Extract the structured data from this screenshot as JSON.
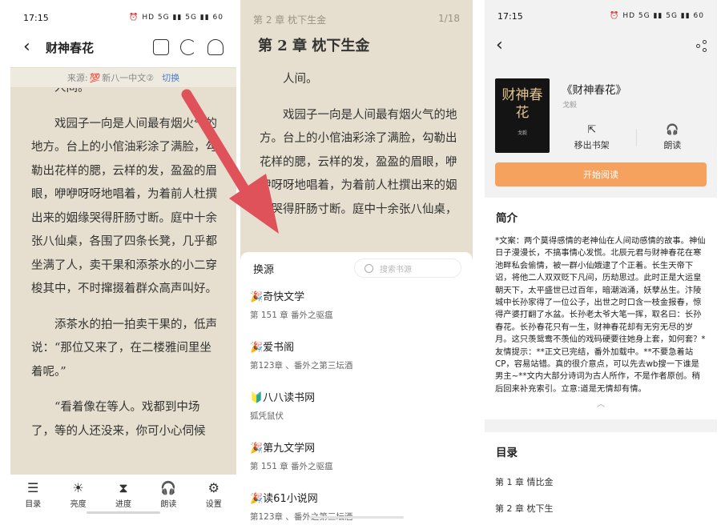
{
  "reader": {
    "time": "17:15",
    "status_icons": "⏰ HD 5G ▮▮ 5G ▮▮ 60",
    "title": "财神春花",
    "source_label": "来源:",
    "source_logo": "💯",
    "source_name": "新八一中文②",
    "switch_label": "切换",
    "paragraphs": [
      "人间。",
      "戏园子一向是人间最有烟火气的地方。台上的小倌油彩涂了满脸，勾勒出花样的腮，云样的发，盈盈的眉眼，咿咿呀呀地唱着，为着前人杜撰出来的姻缘哭得肝肠寸断。庭中十余张八仙桌，各围了四条长凳，几乎都坐满了人，卖干果和添茶水的小二穿梭其中，不时撺掇着群众高声叫好。",
      "添茶水的拍一拍卖干果的，低声说：“那位又来了，在二楼雅间里坐着呢。”",
      "“看着像在等人。戏都到中场了，等的人还没来，你可小心伺候"
    ],
    "nav": [
      {
        "glyph": "☰",
        "label": "目录"
      },
      {
        "glyph": "☀",
        "label": "亮度"
      },
      {
        "glyph": "⧗",
        "label": "进度"
      },
      {
        "glyph": "🎧",
        "label": "朗读"
      },
      {
        "glyph": "⚙",
        "label": "设置"
      }
    ]
  },
  "switcher": {
    "chapter_short": "第 2 章 枕下生金",
    "page_indicator": "1/18",
    "chapter_title": "第 2 章 枕下生金",
    "paragraphs": [
      "人间。",
      "戏园子一向是人间最有烟火气的地方。台上的小倌油彩涂了满脸，勾勒出花样的腮，云样的发，盈盈的眉眼，咿咿呀呀地唱着，为着前人杜撰出来的姻缘哭得肝肠寸断。庭中十余张八仙桌，"
    ],
    "sheet_title": "换源",
    "search_placeholder": "搜索书源",
    "sources": [
      {
        "name": "🎉奇快文学",
        "chapter": "第 151 章 番外之驱瘟"
      },
      {
        "name": "🎉爱书阁",
        "chapter": "第123章 、番外之第三坛酒"
      },
      {
        "name": "🔰八八读书网",
        "chapter": "狐凭鼠伏"
      },
      {
        "name": "🎉第九文学网",
        "chapter": "第 151 章 番外之驱瘟"
      },
      {
        "name": "🎉读61小说网",
        "chapter": "第123章 、番外之第三坛酒"
      }
    ]
  },
  "detail": {
    "time": "17:15",
    "status_icons": "⏰ HD 5G ▮▮ 5G ▮▮ 60",
    "cover_text": "财神春花",
    "cover_small": "戈毅",
    "title": "《财神春花》",
    "author": "戈毅",
    "actions": [
      {
        "glyph": "⇱",
        "label": "移出书架"
      },
      {
        "glyph": "🎧",
        "label": "朗读"
      }
    ],
    "start_label": "开始阅读",
    "intro_heading": "简介",
    "intro_text": "*文案：两个莫得感情的老神仙在人间动感情的故事。神仙日子漫漫长，不搞事情心发慌。北辰元君与财神春花在寒池畔私会偷情，被一群小仙娥逮了个正着。长生天帝下诏，将他二人双双贬下凡间，历劫思过。此时正是大运皇朝天下，太平盛世已过百年，暗潮汹涌，妖孽丛生。汴陵城中长孙家得了一位公子，出世之时口含一枝金报春，惊得产婆打翻了水盆。长孙老太爷大笔一挥，取名曰：长孙春花。长孙春花只有一生，财神春花却有无穷无尽的岁月。这只羡鸳鸯不羡仙的戏码硬要往她身上套，如何套？*友情提示：**正文已完结，番外加载中。**不要急着站CP，容易站错。真的很介意点，可以先去wb搜一下谁是男主~**文内大部分诗词为古人所作，不是作者原创。稍后回来补充索引。立意:道是无情却有情。",
    "collapse_glyph": "︿",
    "toc_heading": "目录",
    "toc": [
      "第 1 章 情比金",
      "第 2 章 枕下生"
    ]
  },
  "colors": {
    "arrow": "#e0525a",
    "paper": "#e6dfcf",
    "accent": "#f5a25f"
  }
}
